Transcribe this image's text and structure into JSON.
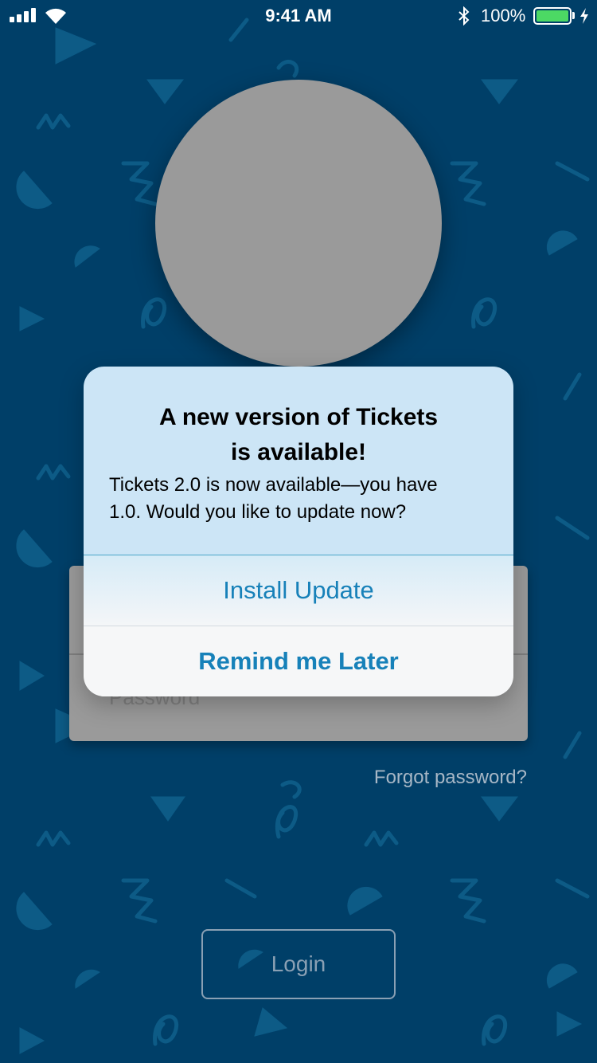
{
  "status_bar": {
    "time": "9:41 AM",
    "battery_percent": "100%",
    "battery_level": 1.0,
    "icons": [
      "signal-icon",
      "wifi-icon",
      "bluetooth-icon",
      "battery-icon",
      "charging-icon"
    ]
  },
  "login_form": {
    "username_placeholder": "",
    "password_placeholder": "Password",
    "forgot_password": "Forgot password?",
    "login_label": "Login"
  },
  "alert": {
    "title_line1": "A new version of Tickets",
    "title_line2": "is available!",
    "message_line1": "Tickets 2.0 is now available—you have",
    "message_line2": "1.0. Would you like to update now?",
    "install_label": "Install Update",
    "remind_label": "Remind me Later"
  },
  "colors": {
    "background": "#003f68",
    "pattern": "#0d5b86",
    "alert_header": "#cce5f6",
    "alert_action_text": "#1781b9",
    "battery_fill": "#4cd964"
  }
}
